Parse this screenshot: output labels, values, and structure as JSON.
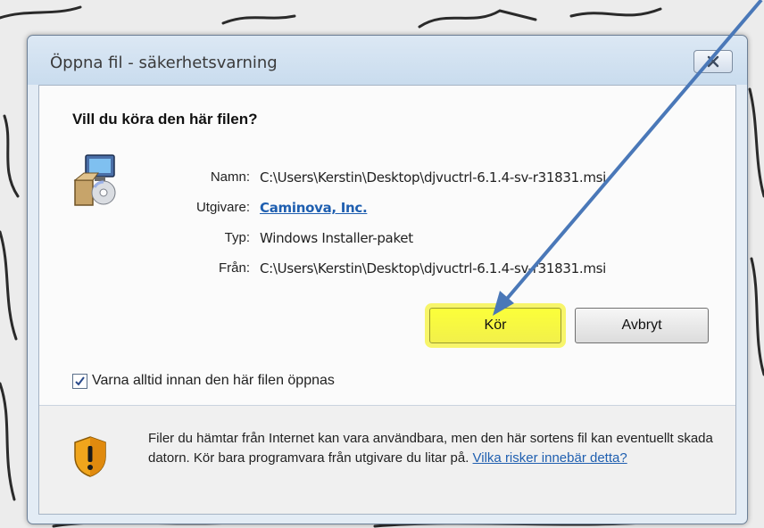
{
  "window": {
    "title": "Öppna fil - säkerhetsvarning"
  },
  "dialog": {
    "heading": "Vill du köra den här filen?",
    "rows": [
      {
        "label": "Namn:",
        "value": "C:\\Users\\Kerstin\\Desktop\\djvuctrl-6.1.4-sv-r31831.msi"
      },
      {
        "label": "Utgivare:",
        "value": "Caminova, Inc."
      },
      {
        "label": "Typ:",
        "value": "Windows Installer-paket"
      },
      {
        "label": "Från:",
        "value": "C:\\Users\\Kerstin\\Desktop\\djvuctrl-6.1.4-sv-r31831.msi"
      }
    ],
    "buttons": {
      "run": "Kör",
      "cancel": "Avbryt"
    },
    "checkbox": {
      "label": "Varna alltid innan den här filen öppnas",
      "checked": true
    },
    "footer": {
      "text": "Filer du hämtar från Internet kan vara användbara, men den här sortens fil kan eventuellt skada datorn. Kör bara programvara från utgivare du litar på.",
      "link": "Vilka risker innebär detta?"
    }
  },
  "colors": {
    "highlight": "#f7f56a",
    "link": "#1f5fb0",
    "arrow": "#4a78b8"
  },
  "icons": [
    "close-icon",
    "installer-package-icon",
    "checkmark-icon",
    "warning-shield-icon",
    "annotation-arrow"
  ]
}
